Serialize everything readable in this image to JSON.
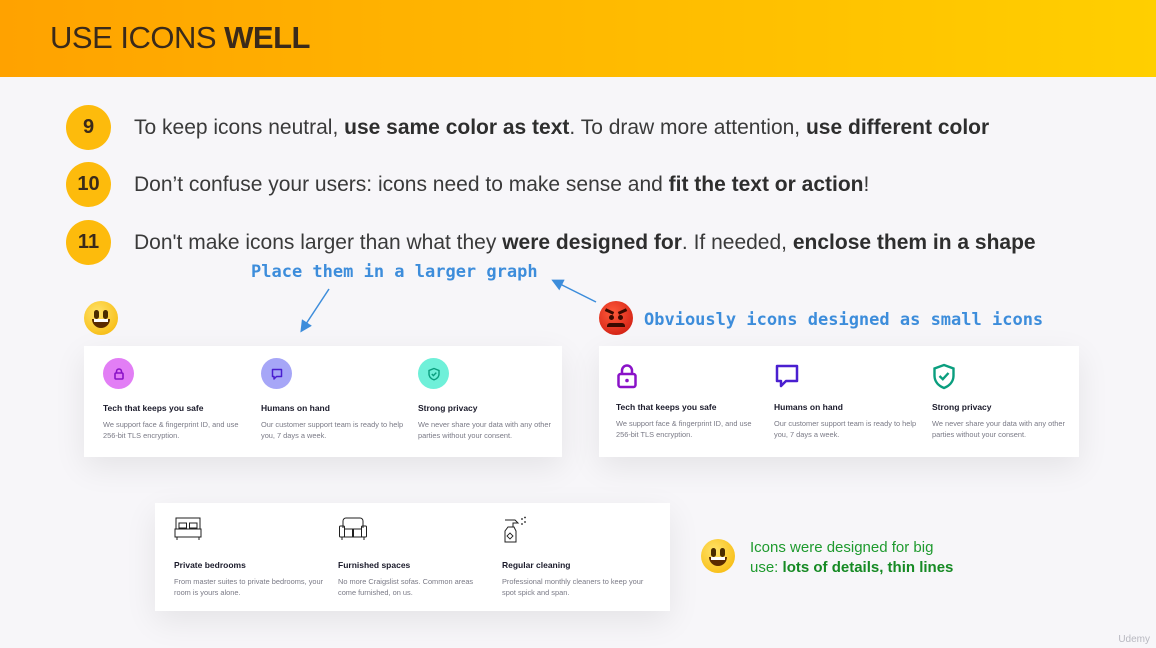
{
  "header": {
    "title_normal": "USE ICONS",
    "title_bold": "WELL"
  },
  "rules": [
    {
      "number": "9",
      "parts": [
        {
          "text": "To keep icons neutral, ",
          "bold": false
        },
        {
          "text": "use same color as text",
          "bold": true
        },
        {
          "text": ". To draw more attention, ",
          "bold": false
        },
        {
          "text": "use different color",
          "bold": true
        }
      ]
    },
    {
      "number": "10",
      "parts": [
        {
          "text": "Don’t confuse your users: icons need to make sense and ",
          "bold": false
        },
        {
          "text": "fit the text or action",
          "bold": true
        },
        {
          "text": "!",
          "bold": false
        }
      ]
    },
    {
      "number": "11",
      "parts": [
        {
          "text": "Don't make icons larger than what they ",
          "bold": false
        },
        {
          "text": "were designed for",
          "bold": true
        },
        {
          "text": ". If needed, ",
          "bold": false
        },
        {
          "text": "enclose them in a shape",
          "bold": true
        }
      ]
    }
  ],
  "annotations": {
    "larger_graph": "Place them in a larger graph",
    "small_icons": "Obviously icons designed as small icons"
  },
  "features": [
    {
      "title": "Tech that keeps you safe",
      "desc": "We support face & fingerprint ID, and use 256-bit TLS encryption.",
      "icon": "lock-icon"
    },
    {
      "title": "Humans on hand",
      "desc": "Our customer support team is ready to help you, 7 days a week.",
      "icon": "chat-bubble-icon"
    },
    {
      "title": "Strong privacy",
      "desc": "We never share your data with any other parties without your consent.",
      "icon": "shield-check-icon"
    }
  ],
  "big_features": [
    {
      "title": "Private bedrooms",
      "desc": "From master suites to private bedrooms, your room is yours alone.",
      "icon": "bed-icon"
    },
    {
      "title": "Furnished spaces",
      "desc": "No more Craigslist sofas. Common areas come furnished, on us.",
      "icon": "sofa-icon"
    },
    {
      "title": "Regular cleaning",
      "desc": "Professional monthly cleaners to keep your spot spick and span.",
      "icon": "spray-bottle-icon"
    }
  ],
  "green_note": {
    "line1": "Icons were designed for big",
    "line2_normal": "use: ",
    "line2_bold": "lots of details, thin lines"
  },
  "colors": {
    "accent_orange": "#fdbb0c",
    "annotation_blue": "#3d8ddb",
    "note_green": "#1e9a2e",
    "lock_pink": "#e27ef5",
    "lock_purple": "#8a12c8",
    "chat_lavender": "#a6a6f7",
    "chat_indigo": "#4a1fd0",
    "shield_teal": "#6ff0d9",
    "shield_green": "#0a9e7e"
  },
  "watermark": "Udemy"
}
